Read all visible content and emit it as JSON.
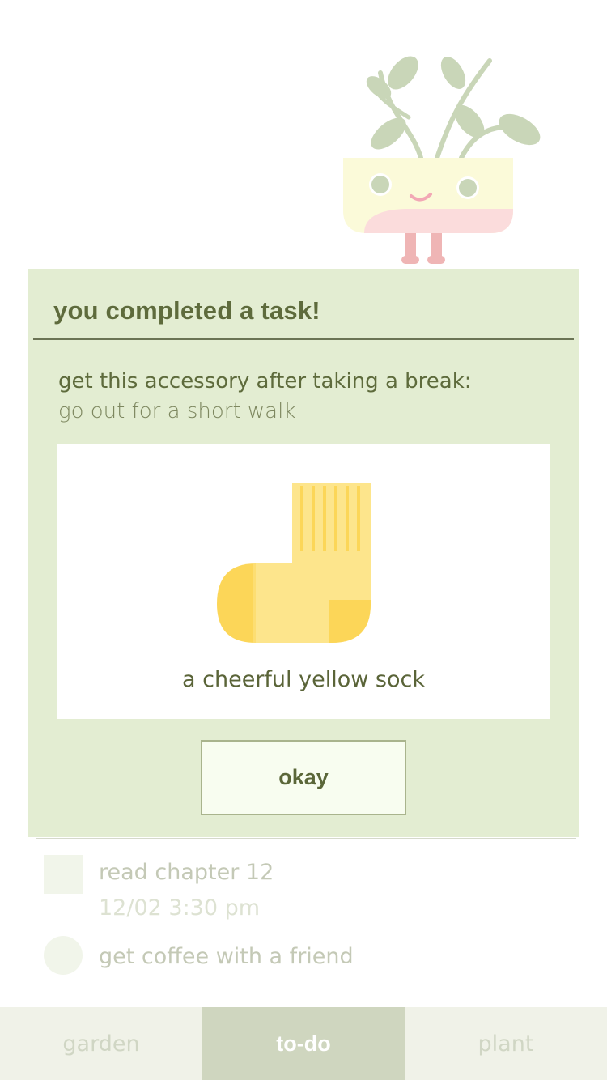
{
  "modal": {
    "title": "you completed a task!",
    "subtitle": "get this accessory after taking a break:",
    "break_activity": "go out for a short walk",
    "reward_name": "a cheerful yellow sock",
    "reward_icon": "yellow-sock-icon",
    "okay_label": "okay"
  },
  "tasks": [
    {
      "title": "read chapter 12",
      "date": "12/02 3:30 pm",
      "checkbox": "square"
    },
    {
      "title": "get coffee with a friend",
      "checkbox": "circle"
    }
  ],
  "tabs": [
    {
      "label": "garden",
      "active": false
    },
    {
      "label": "to-do",
      "active": true
    },
    {
      "label": "plant",
      "active": false
    }
  ],
  "colors": {
    "modal_bg": "#e3edd2",
    "text_dark": "#5e6b3c",
    "active_tab": "#cfd6bf",
    "sock_yellow": "#fde58c",
    "sock_dark_yellow": "#fcd658"
  }
}
